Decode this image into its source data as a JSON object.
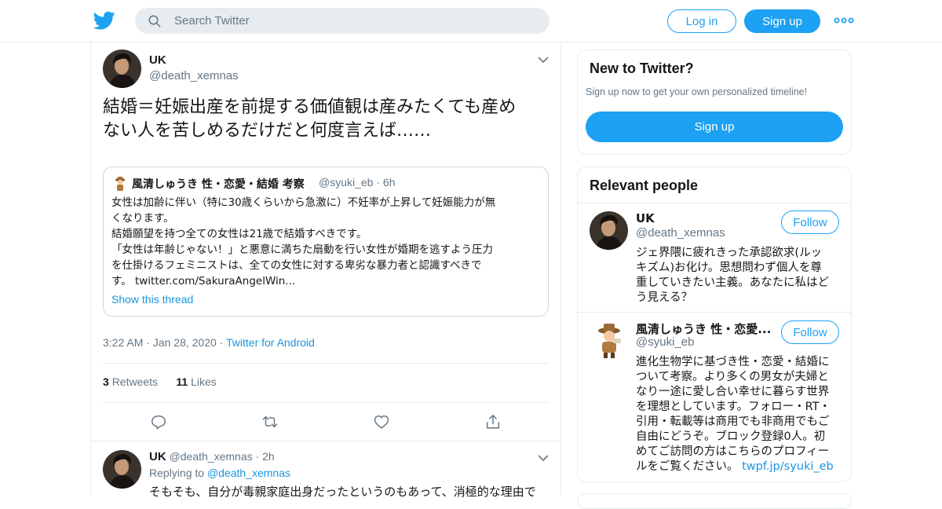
{
  "header": {
    "logo_icon": "twitter-bird-icon",
    "search_placeholder": "Search Twitter",
    "login_label": "Log in",
    "signup_label": "Sign up",
    "more_icon": "more-dots-icon"
  },
  "tweet": {
    "name": "UK",
    "handle": "@death_xemnas",
    "text_lines": [
      "結婚＝妊娠出産を前提する価値観は産みたくても産め",
      "ない人を苦しめるだけだと何度言えば……"
    ],
    "quote": {
      "name": "風清しゅうき 性・恋愛・結婚 考察",
      "handle": "@syuki_eb",
      "time": "6h",
      "lines": [
        "女性は加齢に伴い（特に30歳くらいから急激に）不妊率が上昇して妊娠能力が無",
        "くなります。",
        "結婚願望を持つ全ての女性は21歳で結婚すべきです。",
        "「女性は年齢じゃない！」と悪意に満ちた扇動を行い女性が婚期を逃すよう圧力",
        "を仕掛けるフェミニストは、全ての女性に対する卑劣な暴力者と認識すべきで",
        "す。 twitter.com/SakuraAngelWin..."
      ],
      "show_thread": "Show this thread"
    },
    "time": "3:22 AM",
    "date": "Jan 28, 2020",
    "source": "Twitter for Android",
    "retweets_count": "3",
    "retweets_label": "Retweets",
    "likes_count": "11",
    "likes_label": "Likes",
    "actions": [
      "reply-icon",
      "retweet-icon",
      "like-icon",
      "share-icon"
    ]
  },
  "reply": {
    "name": "UK",
    "handle": "@death_xemnas",
    "time": "2h",
    "replying_prefix": "Replying to",
    "replying_to": "@death_xemnas",
    "text": "そもそも、自分が毒親家庭出身だったというのもあって、消極的な理由で"
  },
  "sidebar": {
    "new_title": "New to Twitter?",
    "new_sub": "Sign up now to get your own personalized timeline!",
    "new_button": "Sign up",
    "relevant_title": "Relevant people",
    "people": [
      {
        "name": "UK",
        "handle": "@death_xemnas",
        "follow": "Follow",
        "bio_lines": [
          "ジェ界隈に疲れきった承認欲求(ルッ",
          "キズム)お化け。思想問わず個人を尊",
          "重していきたい主義。あなたに私はど",
          "う見える？"
        ]
      },
      {
        "name": "風清しゅうき 性・恋愛...",
        "handle": "@syuki_eb",
        "follow": "Follow",
        "bio_lines": [
          "進化生物学に基づき性・恋愛・結婚に",
          "ついて考察。より多くの男女が夫婦と",
          "なり一途に愛し合い幸せに暮らす世界",
          "を理想としています。フォロー・RT・",
          "引用・転載等は商用でも非商用でもご",
          "自由にどうぞ。ブロック登録0人。初",
          "めてご訪問の方はこちらのプロフィー"
        ],
        "bio_last": "ルをご覧ください。",
        "bio_link": "twpf.jp/syuki_eb"
      }
    ]
  },
  "colors": {
    "brand": "#1da1f2",
    "link": "#1b95e0",
    "muted": "#657786",
    "border": "#e6ecf0"
  }
}
